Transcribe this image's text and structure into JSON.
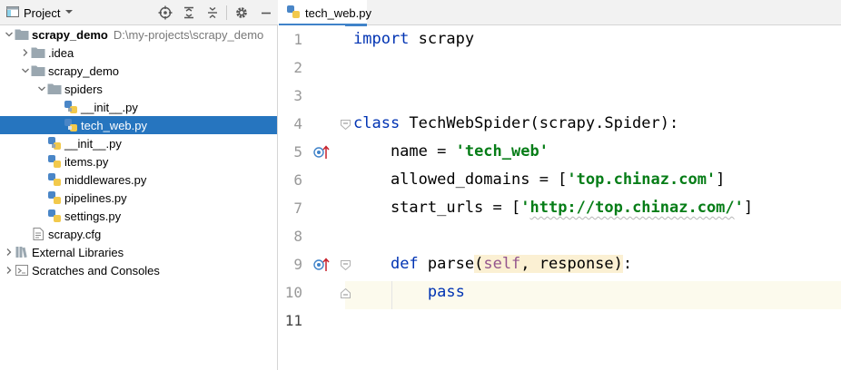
{
  "project_panel": {
    "title": "Project",
    "tree": [
      {
        "label": "scrapy_demo",
        "path": "D:\\my-projects\\scrapy_demo",
        "kind": "root-folder",
        "expanded": true
      },
      {
        "label": ".idea",
        "kind": "folder",
        "expanded": false
      },
      {
        "label": "scrapy_demo",
        "kind": "folder",
        "expanded": true
      },
      {
        "label": "spiders",
        "kind": "folder",
        "expanded": true
      },
      {
        "label": "__init__.py",
        "kind": "python-file"
      },
      {
        "label": "tech_web.py",
        "kind": "python-file",
        "selected": true
      },
      {
        "label": "__init__.py",
        "kind": "python-file"
      },
      {
        "label": "items.py",
        "kind": "python-file"
      },
      {
        "label": "middlewares.py",
        "kind": "python-file"
      },
      {
        "label": "pipelines.py",
        "kind": "python-file"
      },
      {
        "label": "settings.py",
        "kind": "python-file"
      },
      {
        "label": "scrapy.cfg",
        "kind": "config-file"
      },
      {
        "label": "External Libraries",
        "kind": "libraries",
        "expanded": false
      },
      {
        "label": "Scratches and Consoles",
        "kind": "scratches",
        "expanded": false
      }
    ]
  },
  "editor": {
    "active_tab": "tech_web.py",
    "current_line": "11",
    "line_numbers": [
      "1",
      "2",
      "3",
      "4",
      "5",
      "6",
      "7",
      "8",
      "9",
      "10",
      "11"
    ],
    "code": {
      "l1_kw": "import",
      "l1_rest": " scrapy",
      "l4_kw": "class",
      "l4_rest": " TechWebSpider(scrapy.Spider):",
      "l5_indent": "    name = ",
      "l5_str": "'tech_web'",
      "l6_indent": "    allowed_domains = [",
      "l6_str": "'top.chinaz.com'",
      "l6_end": "]",
      "l7_indent": "    start_urls = [",
      "l7_q1": "'",
      "l7_url": "http://top.chinaz.com/",
      "l7_q2": "'",
      "l7_end": "]",
      "l9_indent": "    ",
      "l9_kw": "def",
      "l9_name": " parse",
      "l9_paren_open": "(",
      "l9_self": "self",
      "l9_args": ", response",
      "l9_paren_close": ")",
      "l9_colon": ":",
      "l10_indent": "        ",
      "l10_kw": "pass"
    }
  },
  "icons": [
    "project-view-icon",
    "dropdown-arrow-icon",
    "locate-icon",
    "expand-all-icon",
    "collapse-all-icon",
    "gear-icon",
    "minimize-icon",
    "python-file-icon",
    "folder-icon",
    "override-method-icon",
    "fold-icon"
  ],
  "colors": {
    "selection": "#2675bf",
    "keyword": "#0033b3",
    "string": "#067d17",
    "self": "#94558d",
    "current_line": "#fcfaed",
    "tab_underline": "#4083c9"
  }
}
